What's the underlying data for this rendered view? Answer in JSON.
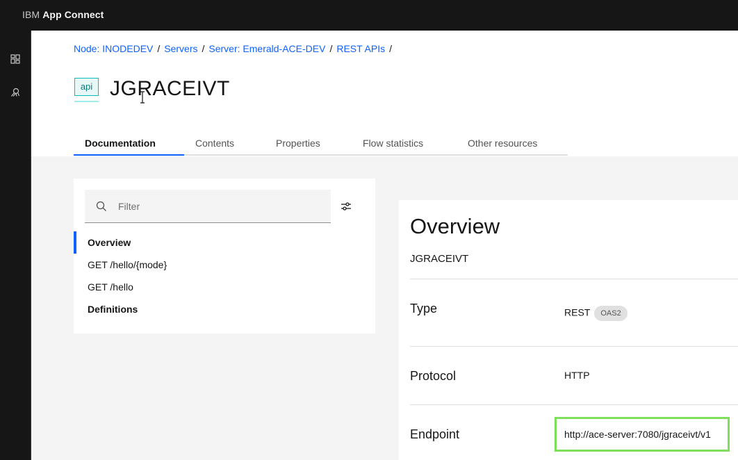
{
  "header": {
    "brand_prefix": "IBM",
    "brand_name": "App Connect"
  },
  "rail": {
    "icons": [
      "dashboard-icon",
      "catalog-icon"
    ]
  },
  "breadcrumb": {
    "items": [
      "Node: INODEDEV",
      "Servers",
      "Server: Emerald-ACE-DEV",
      "REST APIs"
    ],
    "separator": "/"
  },
  "page": {
    "badge": "api",
    "title": "JGRACEIVT"
  },
  "tabs": [
    "Documentation",
    "Contents",
    "Properties",
    "Flow statistics",
    "Other resources"
  ],
  "active_tab": "Documentation",
  "filter": {
    "placeholder": "Filter",
    "value": ""
  },
  "nav": {
    "items": [
      "Overview",
      "GET /hello/{mode}",
      "GET /hello",
      "Definitions"
    ],
    "selected": "Overview"
  },
  "overview": {
    "title": "Overview",
    "subtitle": "JGRACEIVT",
    "type_label": "Type",
    "type_value": "REST",
    "type_tag": "OAS2",
    "protocol_label": "Protocol",
    "protocol_value": "HTTP",
    "endpoint_label": "Endpoint",
    "endpoint_value": "http://ace-server:7080/jgraceivt/v1"
  },
  "colors": {
    "accent": "#0f62fe",
    "highlight": "#7ee05a",
    "topbar": "#161616"
  }
}
